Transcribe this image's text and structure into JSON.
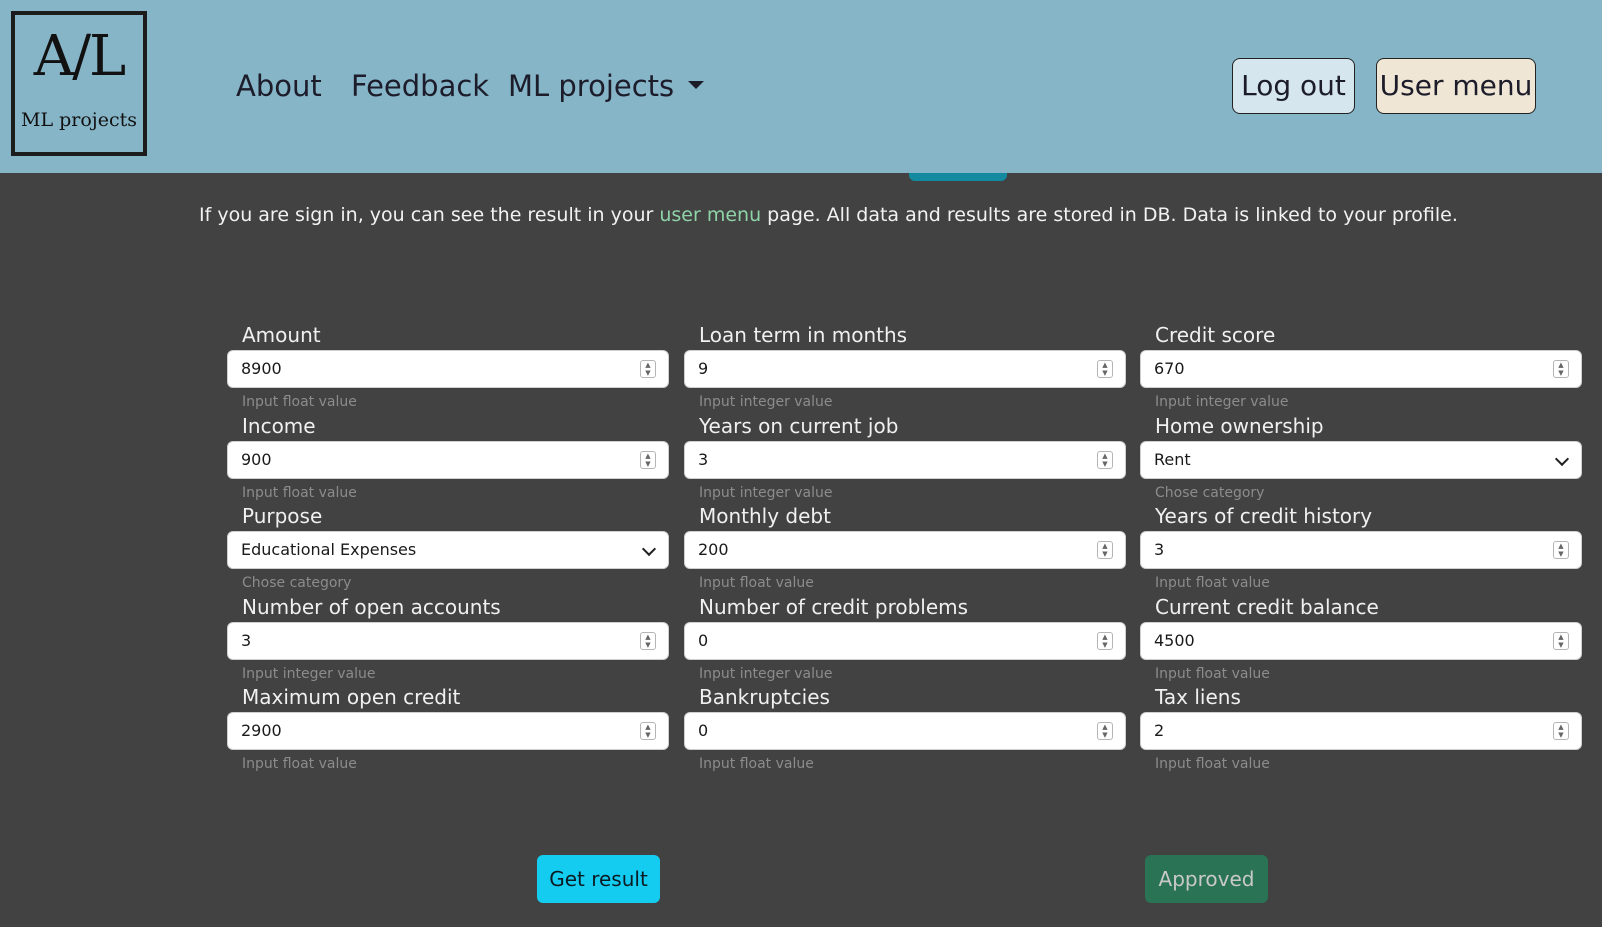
{
  "brand": {
    "logo_main": "A/L",
    "logo_sub": "ML projects"
  },
  "nav": {
    "about": "About",
    "feedback": "Feedback",
    "ml_projects": "ML projects",
    "logout": "Log out",
    "user_menu": "User menu"
  },
  "info": {
    "before_link": "If you are sign in, you can see the result in your ",
    "link": "user menu",
    "after_link": " page. All data and results are stored in DB. Data is linked to your profile."
  },
  "fields": [
    {
      "label": "Amount",
      "value": "8900",
      "help": "Input float value",
      "type": "number"
    },
    {
      "label": "Loan term in months",
      "value": "9",
      "help": "Input integer value",
      "type": "number"
    },
    {
      "label": "Credit score",
      "value": "670",
      "help": "Input integer value",
      "type": "number"
    },
    {
      "label": "Income",
      "value": "900",
      "help": "Input float value",
      "type": "number"
    },
    {
      "label": "Years on current job",
      "value": "3",
      "help": "Input integer value",
      "type": "number"
    },
    {
      "label": "Home ownership",
      "value": "Rent",
      "help": "Chose category",
      "type": "select"
    },
    {
      "label": "Purpose",
      "value": "Educational Expenses",
      "help": "Chose category",
      "type": "select"
    },
    {
      "label": "Monthly debt",
      "value": "200",
      "help": "Input float value",
      "type": "number"
    },
    {
      "label": "Years of credit history",
      "value": "3",
      "help": "Input float value",
      "type": "number"
    },
    {
      "label": "Number of open accounts",
      "value": "3",
      "help": "Input integer value",
      "type": "number"
    },
    {
      "label": "Number of credit problems",
      "value": "0",
      "help": "Input integer value",
      "type": "number"
    },
    {
      "label": "Current credit balance",
      "value": "4500",
      "help": "Input float value",
      "type": "number"
    },
    {
      "label": "Maximum open credit",
      "value": "2900",
      "help": "Input float value",
      "type": "number"
    },
    {
      "label": "Bankruptcies",
      "value": "0",
      "help": "Input float value",
      "type": "number"
    },
    {
      "label": "Tax liens",
      "value": "2",
      "help": "Input float value",
      "type": "number"
    }
  ],
  "actions": {
    "get_result": "Get result",
    "result": "Approved"
  },
  "colors": {
    "navbar": "#86b5c8",
    "background": "#424242",
    "link": "#8fd4a8",
    "get_result": "#14cbf0",
    "approved": "#2a7355",
    "logout_bg": "#d6e6ee",
    "user_menu_bg": "#efe6d5"
  }
}
